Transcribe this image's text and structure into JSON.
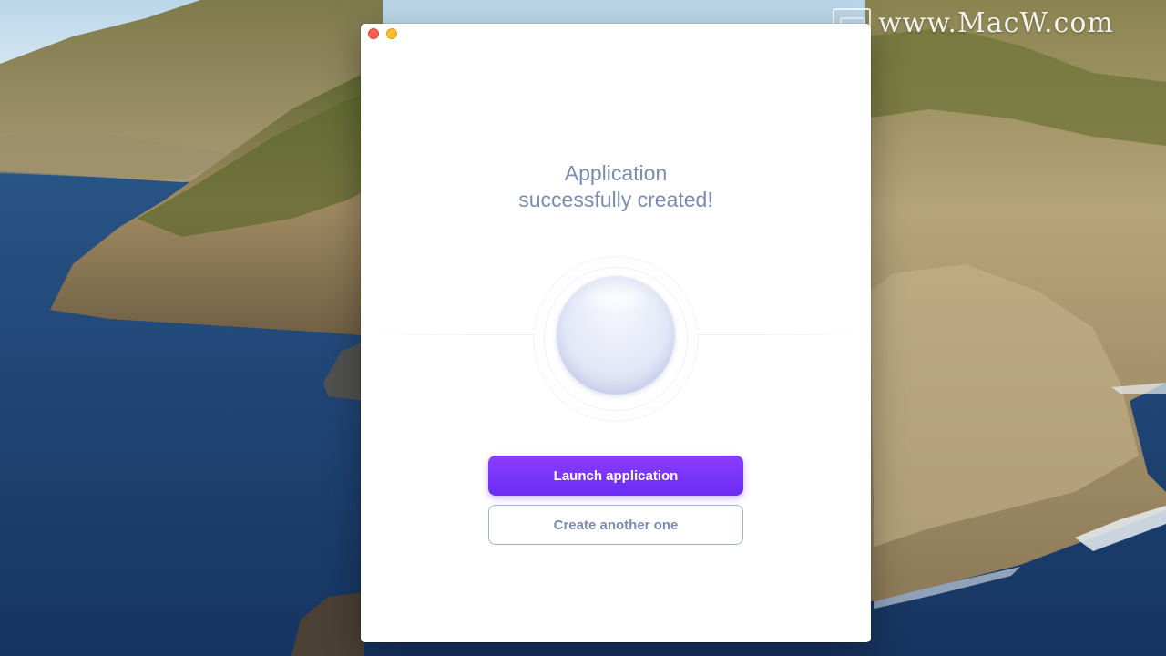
{
  "watermark": {
    "text": "www.MacW.com",
    "logo_icon": "monitor-logo-icon"
  },
  "window": {
    "controls": {
      "close_icon": "close-icon",
      "minimize_icon": "minimize-icon",
      "close_color": "#fe5f57",
      "minimize_color": "#febc2e"
    },
    "headline_line1": "Application",
    "headline_line2": "successfully created!",
    "success_graphic_icon": "success-orb-icon",
    "primary_button_label": "Launch application",
    "secondary_button_label": "Create another one"
  },
  "colors": {
    "accent": "#7433fa",
    "muted_text": "#7b8bb2",
    "secondary_border": "#9fb0d6"
  }
}
